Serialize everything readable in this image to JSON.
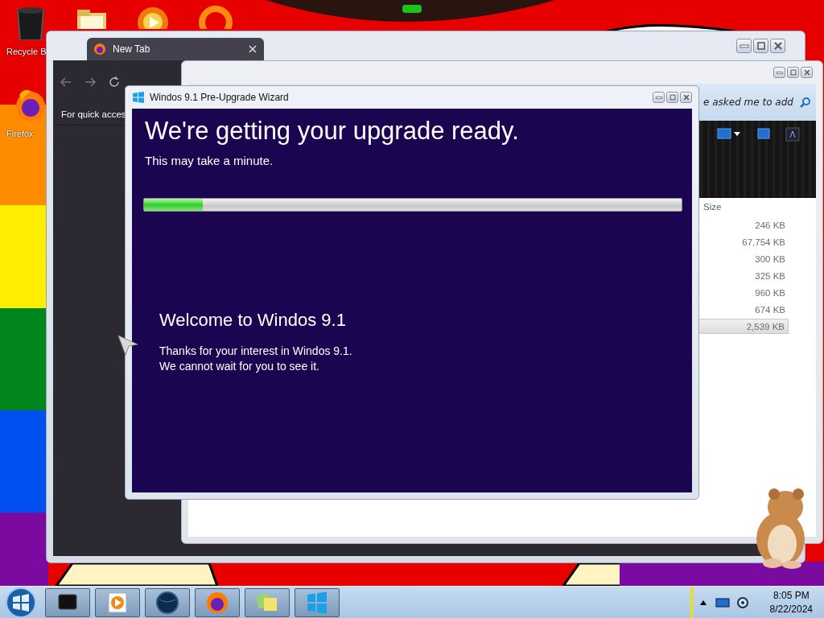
{
  "desktop_icons": [
    {
      "kind": "bin",
      "label": "Recycle B"
    },
    {
      "kind": "firefox",
      "label": "Firefox"
    },
    {
      "kind": "folder"
    },
    {
      "kind": "media"
    },
    {
      "kind": "ring"
    }
  ],
  "browser": {
    "tab": {
      "title": "New Tab"
    },
    "bookmarks_text": "For quick acces"
  },
  "explorer": {
    "search": {
      "placeholder": "e asked me to add"
    },
    "columns": [
      "Size"
    ],
    "rows": [
      {
        "size": "246 KB",
        "selected": false
      },
      {
        "size": "67,754 KB",
        "selected": false
      },
      {
        "size": "300 KB",
        "selected": false
      },
      {
        "size": "325 KB",
        "selected": false
      },
      {
        "size": "960 KB",
        "selected": false
      },
      {
        "size": "674 KB",
        "selected": false
      },
      {
        "size": "2,539 KB",
        "selected": true
      }
    ]
  },
  "wizard": {
    "title": "Windos 9.1 Pre-Upgrade Wizard",
    "heading": "We're getting your upgrade ready.",
    "subheading": "This may take a minute.",
    "progress": {
      "level": 0.11
    },
    "welcome_title": "Welcome to Windos 9.1",
    "welcome_text": "Thanks for your interest in Windos 9.1.\nWe cannot wait for you to see it."
  },
  "taskbar": {
    "buttons": [
      {
        "kind": "terminal"
      },
      {
        "kind": "media"
      },
      {
        "kind": "globe"
      },
      {
        "kind": "firefox"
      },
      {
        "kind": "notes"
      },
      {
        "kind": "windows"
      }
    ],
    "clock": {
      "time": "8:05 PM",
      "date": "8/22/2024"
    }
  }
}
